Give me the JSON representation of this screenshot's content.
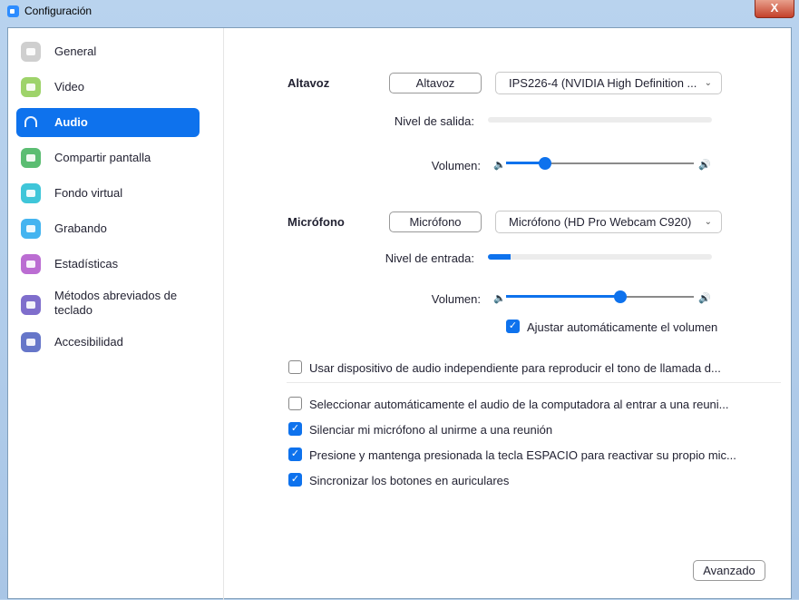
{
  "window": {
    "title": "Configuración",
    "close": "X"
  },
  "sidebar": {
    "items": [
      {
        "label": "General",
        "color": "#cfcfcf",
        "icon": "gear-icon"
      },
      {
        "label": "Video",
        "color": "#9ed36a",
        "icon": "video-camera-icon"
      },
      {
        "label": "Audio",
        "color": "#0e72ed",
        "icon": "headphones-icon",
        "active": true
      },
      {
        "label": "Compartir pantalla",
        "color": "#5bbd72",
        "icon": "share-screen-icon"
      },
      {
        "label": "Fondo virtual",
        "color": "#3fc6d9",
        "icon": "virtual-background-icon"
      },
      {
        "label": "Grabando",
        "color": "#44b4f0",
        "icon": "record-icon"
      },
      {
        "label": "Estadísticas",
        "color": "#bb6dd2",
        "icon": "statistics-icon"
      },
      {
        "label": "Métodos abreviados de teclado",
        "color": "#7f6ecc",
        "icon": "keyboard-icon"
      },
      {
        "label": "Accesibilidad",
        "color": "#6676c9",
        "icon": "accessibility-icon"
      }
    ]
  },
  "speaker": {
    "heading": "Altavoz",
    "test_button": "Altavoz",
    "device": "IPS226-4 (NVIDIA High Definition ...",
    "output_label": "Nivel de salida:",
    "output_level": 0,
    "volume_label": "Volumen:",
    "volume": 0.21
  },
  "microphone": {
    "heading": "Micrófono",
    "test_button": "Micrófono",
    "device": "Micrófono (HD Pro Webcam C920)",
    "input_label": "Nivel de entrada:",
    "input_level": 0.1,
    "volume_label": "Volumen:",
    "volume": 0.61,
    "auto_adjust": {
      "label": "Ajustar automáticamente el volumen",
      "checked": true
    }
  },
  "options": [
    {
      "label": "Usar dispositivo de audio independiente para reproducir el tono de llamada d...",
      "checked": false
    },
    {
      "label": "Seleccionar automáticamente el audio de la computadora al entrar a una reuni...",
      "checked": false
    },
    {
      "label": "Silenciar mi micrófono al unirme a una reunión",
      "checked": true
    },
    {
      "label": "Presione y mantenga presionada la tecla ESPACIO para reactivar su propio mic...",
      "checked": true
    },
    {
      "label": "Sincronizar los botones en auriculares",
      "checked": true
    }
  ],
  "advanced_button": "Avanzado"
}
